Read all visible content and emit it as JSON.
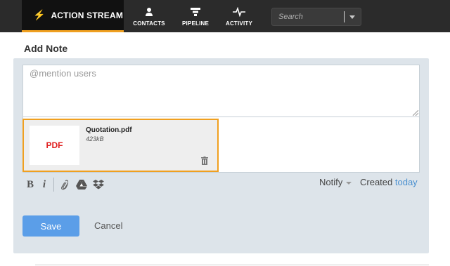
{
  "nav": {
    "active_tab": "ACTION STREAM",
    "items": [
      {
        "label": "CONTACTS",
        "icon": "person-icon"
      },
      {
        "label": "PIPELINE",
        "icon": "funnel-icon"
      },
      {
        "label": "ACTIVITY",
        "icon": "pulse-icon"
      }
    ],
    "search_placeholder": "Search"
  },
  "note": {
    "title": "Add Note",
    "textarea_placeholder": "@mention users",
    "attachment": {
      "thumb_label": "PDF",
      "filename": "Quotation.pdf",
      "size": "423kB"
    },
    "toolbar": {
      "bold_label": "B",
      "italic_label": "i"
    },
    "notify_label": "Notify",
    "created_label": "Created",
    "created_value": "today",
    "save_label": "Save",
    "cancel_label": "Cancel"
  },
  "colors": {
    "accent": "#f0a020",
    "primary_button": "#5b9ee8",
    "link": "#4a90d0",
    "pdf_red": "#e02020"
  }
}
